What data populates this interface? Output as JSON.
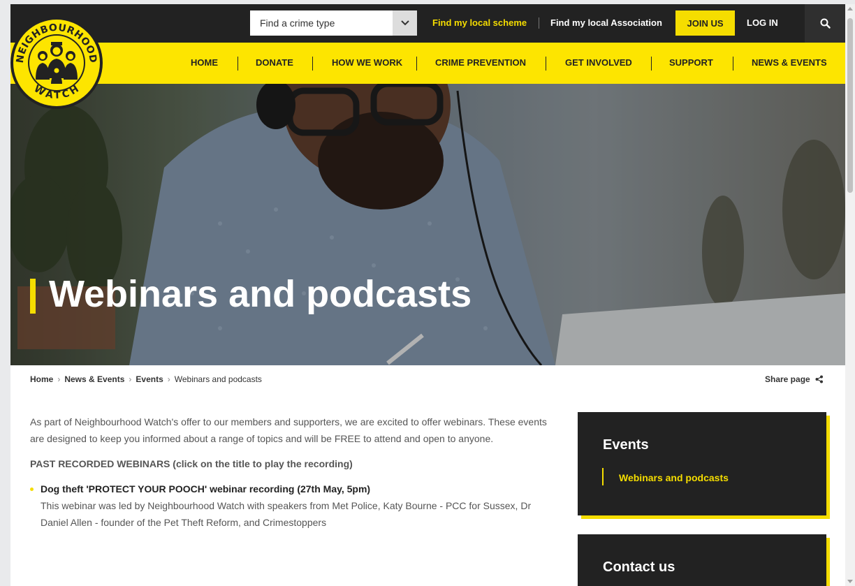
{
  "topbar": {
    "crime_select_placeholder": "Find a crime type",
    "find_scheme": "Find my local scheme",
    "find_association": "Find my local Association",
    "join": "JOIN US",
    "login": "LOG IN"
  },
  "nav": {
    "items": [
      "HOME",
      "DONATE",
      "HOW WE WORK",
      "CRIME PREVENTION",
      "GET INVOLVED",
      "SUPPORT",
      "NEWS & EVENTS"
    ]
  },
  "logo": {
    "top_text": "NEIGHBOURHOOD",
    "bottom_text": "WATCH"
  },
  "hero": {
    "title": "Webinars and podcasts"
  },
  "breadcrumb": {
    "items": [
      "Home",
      "News & Events",
      "Events",
      "Webinars and podcasts"
    ],
    "share": "Share page"
  },
  "main": {
    "intro": "As part of Neighbourhood Watch's offer to our members and supporters, we are excited to offer webinars.  These events are designed to keep you informed about a range of topics and will be FREE to attend and open to anyone.",
    "past_heading": "PAST RECORDED WEBINARS (click on the title to play the recording)",
    "webinars": [
      {
        "title": "Dog theft 'PROTECT YOUR POOCH' webinar recording (27th May, 5pm)",
        "description": "This webinar was led by Neighbourhood Watch with speakers from Met Police, Katy Bourne - PCC for Sussex, Dr Daniel Allen - founder of the Pet Theft Reform, and Crimestoppers"
      }
    ]
  },
  "sidebar": {
    "events_title": "Events",
    "events_link": "Webinars and podcasts",
    "contact_title": "Contact us"
  },
  "colors": {
    "brand_yellow": "#f5dd00",
    "dark": "#222222"
  }
}
